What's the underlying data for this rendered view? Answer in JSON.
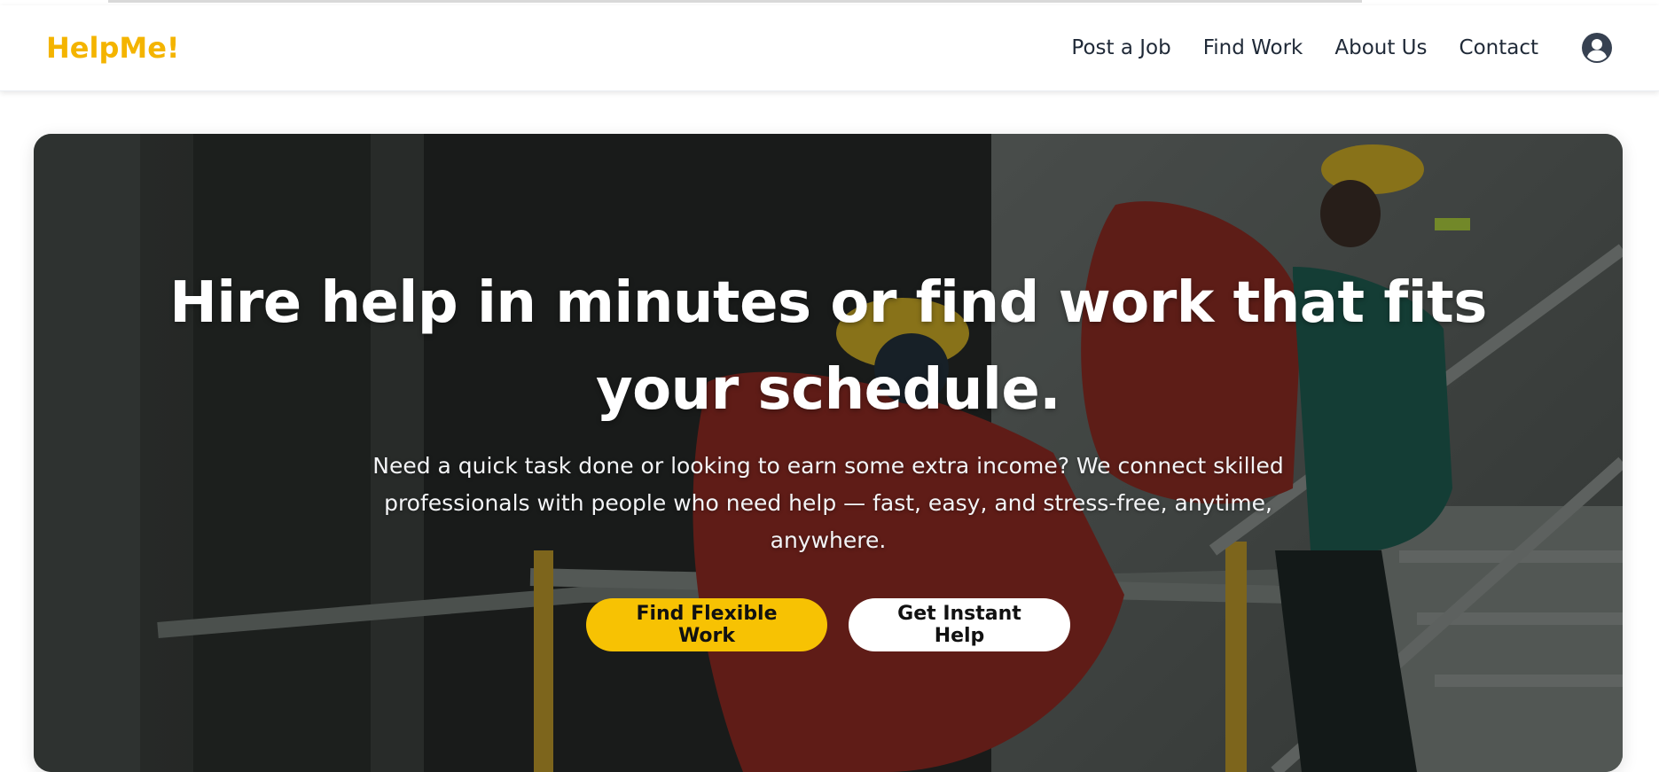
{
  "brand": {
    "logo": "HelpMe!",
    "accent": "#f7c203",
    "logo_color": "#f4b400"
  },
  "nav": {
    "links": [
      "Post a Job",
      "Find Work",
      "About Us",
      "Contact"
    ],
    "account_icon": "user-circle-icon"
  },
  "hero": {
    "title": "Hire help in minutes or find work that fits your schedule.",
    "subtitle": "Need a quick task done or looking to earn some extra income? We connect skilled professionals with people who need help — fast, easy, and stress-free, anytime, anywhere.",
    "primary_button": "Find Flexible Work",
    "secondary_button": "Get Instant Help",
    "background": "construction-workers-carrying-red-bags-photo"
  }
}
